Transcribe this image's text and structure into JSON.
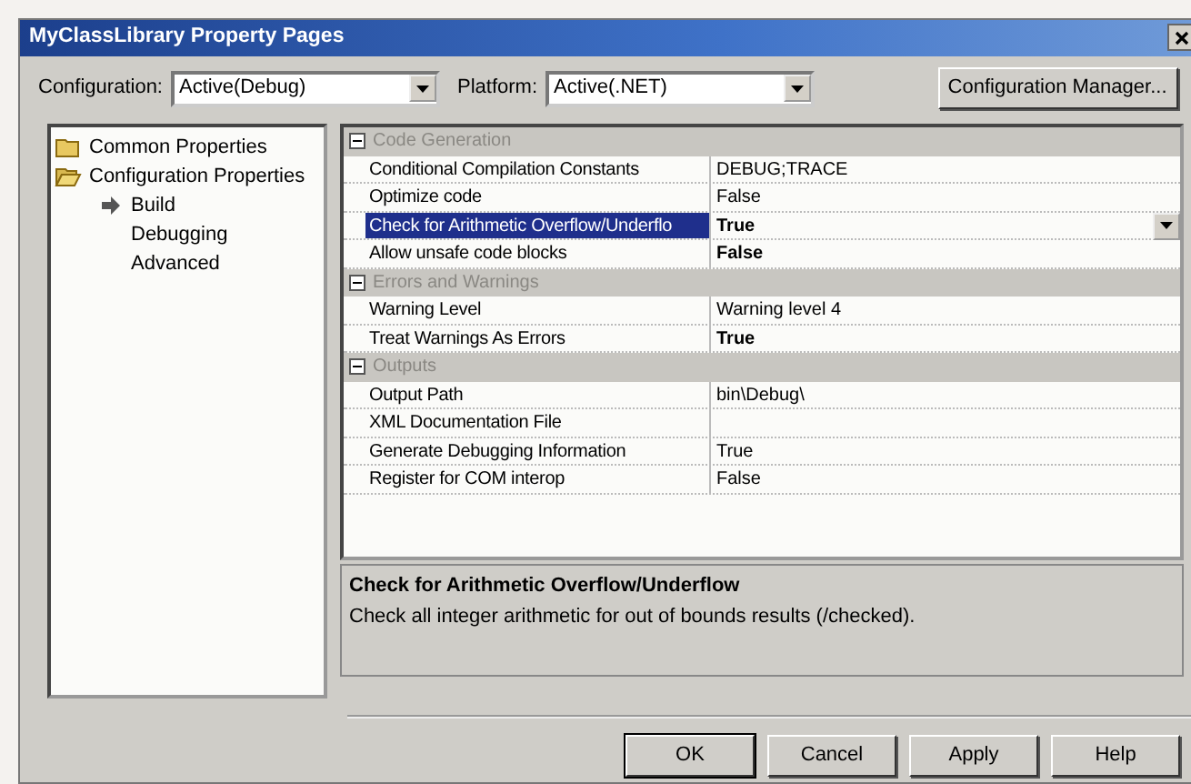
{
  "window": {
    "title": "MyClassLibrary Property Pages"
  },
  "toolbar": {
    "configuration": {
      "label": "Configuration:",
      "value": "Active(Debug)"
    },
    "platform": {
      "label": "Platform:",
      "value": "Active(.NET)"
    },
    "button": "Configuration Manager..."
  },
  "tree": [
    {
      "label": "Common Properties",
      "kind": "folder"
    },
    {
      "label": "Configuration Properties",
      "kind": "open-folder",
      "expanded": true,
      "children": [
        {
          "label": "Build",
          "selected": true
        },
        {
          "label": "Debugging",
          "selected": false
        },
        {
          "label": "Advanced",
          "selected": false
        }
      ]
    }
  ],
  "grid": [
    {
      "name": "Code Generation",
      "expanded": true,
      "properties": [
        {
          "name": "Conditional Compilation Constants",
          "value": "DEBUG;TRACE",
          "bold": false,
          "selected": false
        },
        {
          "name": "Optimize code",
          "value": "False",
          "bold": false,
          "selected": false
        },
        {
          "name": "Check for Arithmetic Overflow/Underflo",
          "value": "True",
          "bold": true,
          "selected": true
        },
        {
          "name": "Allow unsafe code blocks",
          "value": "False",
          "bold": true,
          "selected": false
        }
      ]
    },
    {
      "name": "Errors and Warnings",
      "expanded": true,
      "properties": [
        {
          "name": "Warning Level",
          "value": "Warning level 4",
          "bold": false,
          "selected": false
        },
        {
          "name": "Treat Warnings As Errors",
          "value": "True",
          "bold": true,
          "selected": false
        }
      ]
    },
    {
      "name": "Outputs",
      "expanded": true,
      "properties": [
        {
          "name": "Output Path",
          "value": "bin\\Debug\\",
          "bold": false,
          "selected": false
        },
        {
          "name": "XML Documentation File",
          "selected": false
        },
        {
          "name": "Generate Debugging Information",
          "value": "True",
          "bold": false,
          "selected": false
        },
        {
          "name": "Register for COM interop",
          "value": "False",
          "bold": false,
          "selected": false
        }
      ]
    }
  ],
  "description": {
    "title": "Check for Arithmetic Overflow/Underflow",
    "text": "Check all integer arithmetic for out of bounds results (/checked)."
  },
  "buttons": [
    {
      "label": "OK",
      "default": true
    },
    {
      "label": "Cancel",
      "default": false
    },
    {
      "label": "Apply",
      "default": false
    },
    {
      "label": "Help",
      "default": false
    }
  ]
}
